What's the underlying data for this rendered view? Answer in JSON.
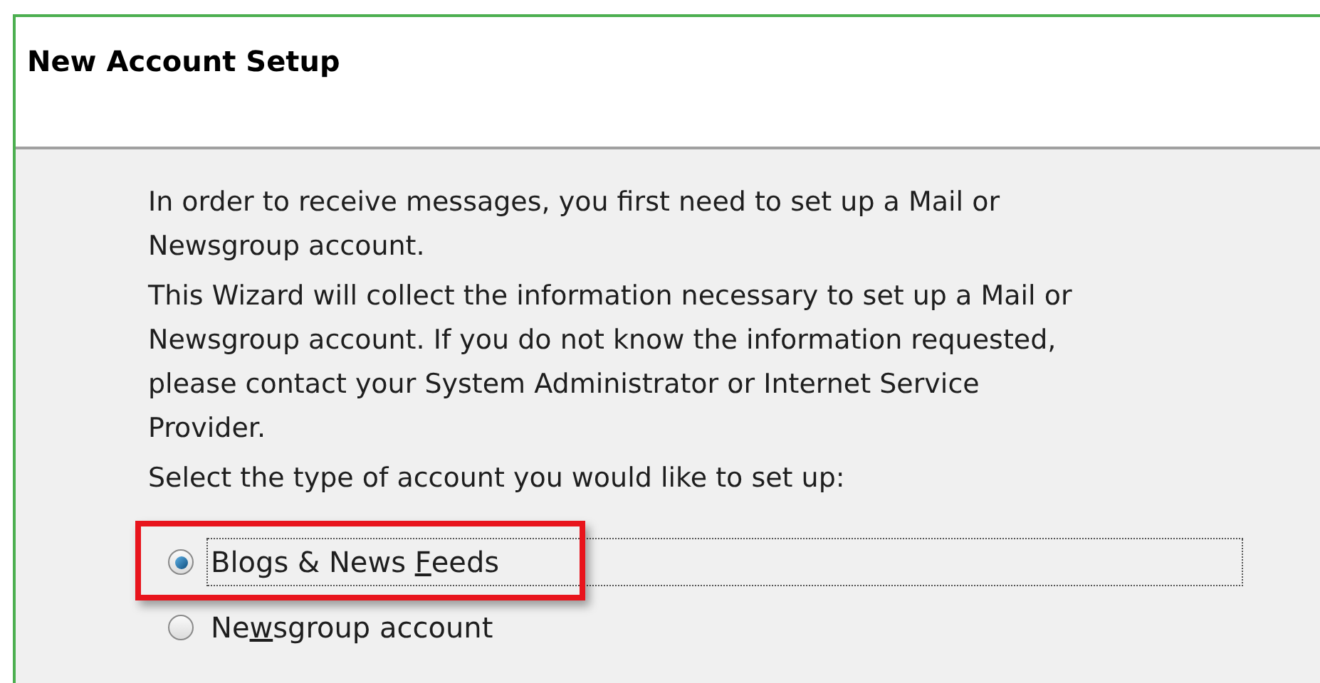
{
  "window": {
    "title": "New Account Setup"
  },
  "paragraphs": [
    "In order to receive messages, you first need to set up a Mail or Newsgroup account.",
    "This Wizard will collect the information necessary to set up a Mail or Newsgroup account. If you do not know the information requested, please contact your System Administrator or Internet Service Provider.",
    "Select the type of account you would like to set up:"
  ],
  "options": [
    {
      "label": {
        "before": "Blogs & News ",
        "key": "F",
        "after": "eeds"
      },
      "selected": true,
      "highlighted": true
    },
    {
      "label": {
        "before": "Ne",
        "key": "w",
        "after": "sgroup account"
      },
      "selected": false,
      "highlighted": false
    }
  ]
}
